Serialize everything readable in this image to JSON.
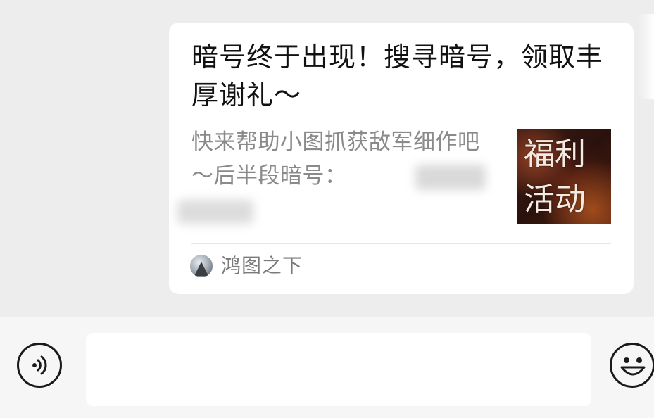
{
  "article_card": {
    "title": "暗号终于出现！搜寻暗号，领取丰厚谢礼～",
    "description": "快来帮助小图抓获敌军细作吧～后半段暗号：",
    "thumbnail": {
      "line1": "福利",
      "line2": "活动"
    },
    "source_name": "鸿图之下"
  },
  "input_bar": {
    "placeholder": "",
    "voice_icon": "voice-icon",
    "emoji_icon": "emoji-icon"
  },
  "colors": {
    "chat_background": "#ededed",
    "card_background": "#ffffff",
    "title_text": "#111111",
    "description_text": "#8a8a8a",
    "input_bar_background": "#f6f6f6"
  }
}
